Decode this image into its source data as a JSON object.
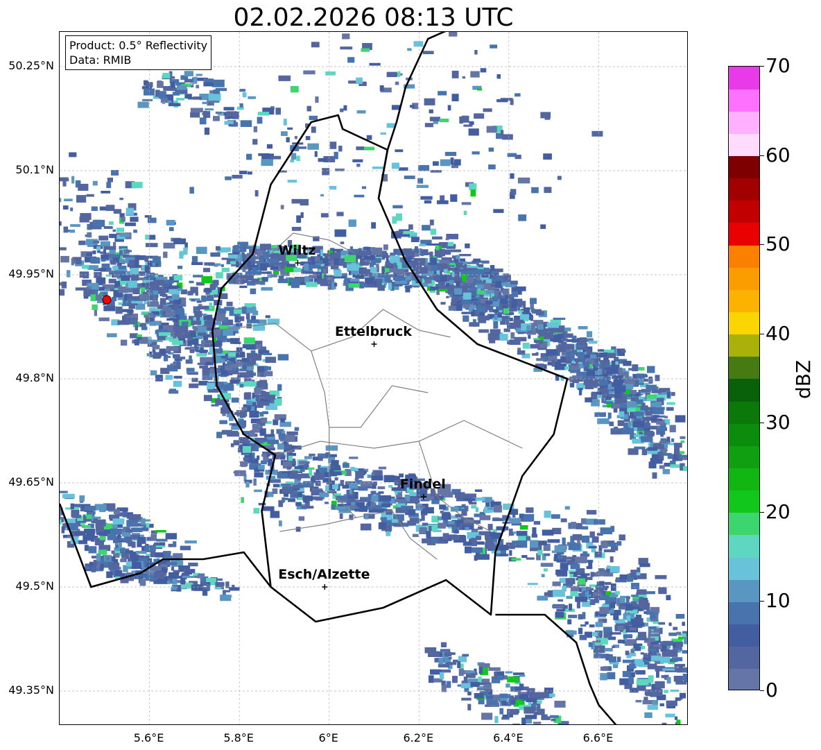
{
  "title": "02.02.2026 08:13 UTC",
  "product_box": {
    "line1": "Product: 0.5° Reflectivity",
    "line2": "Data: RMIB"
  },
  "map": {
    "lon_range": [
      5.4,
      6.8
    ],
    "lat_range": [
      49.3,
      50.3
    ],
    "lat_ticks": [
      {
        "value": 50.25,
        "label": "50.25°N"
      },
      {
        "value": 50.1,
        "label": "50.1°N"
      },
      {
        "value": 49.95,
        "label": "49.95°N"
      },
      {
        "value": 49.8,
        "label": "49.8°N"
      },
      {
        "value": 49.65,
        "label": "49.65°N"
      },
      {
        "value": 49.5,
        "label": "49.5°N"
      },
      {
        "value": 49.35,
        "label": "49.35°N"
      }
    ],
    "lon_ticks": [
      {
        "value": 5.6,
        "label": "5.6°E"
      },
      {
        "value": 5.8,
        "label": "5.8°E"
      },
      {
        "value": 6.0,
        "label": "6°E"
      },
      {
        "value": 6.2,
        "label": "6.2°E"
      },
      {
        "value": 6.4,
        "label": "6.4°E"
      },
      {
        "value": 6.6,
        "label": "6.6°E"
      }
    ],
    "grid": true,
    "cities": [
      {
        "name": "Wiltz",
        "lon": 5.93,
        "lat": 49.967
      },
      {
        "name": "Ettelbruck",
        "lon": 6.1,
        "lat": 49.85
      },
      {
        "name": "Findel",
        "lon": 6.21,
        "lat": 49.63
      },
      {
        "name": "Esch/Alzette",
        "lon": 5.99,
        "lat": 49.5
      }
    ],
    "radar_site": {
      "lon": 5.505,
      "lat": 49.914,
      "color": "#ff0000"
    },
    "lux_border": [
      [
        6.02,
        50.18
      ],
      [
        5.96,
        50.17
      ],
      [
        5.9,
        50.11
      ],
      [
        5.87,
        50.08
      ],
      [
        5.83,
        49.98
      ],
      [
        5.76,
        49.93
      ],
      [
        5.74,
        49.87
      ],
      [
        5.75,
        49.79
      ],
      [
        5.81,
        49.72
      ],
      [
        5.88,
        49.69
      ],
      [
        5.85,
        49.61
      ],
      [
        5.87,
        49.5
      ],
      [
        5.97,
        49.45
      ],
      [
        6.12,
        49.47
      ],
      [
        6.26,
        49.51
      ],
      [
        6.36,
        49.46
      ],
      [
        6.37,
        49.55
      ],
      [
        6.43,
        49.66
      ],
      [
        6.5,
        49.72
      ],
      [
        6.53,
        49.8
      ],
      [
        6.45,
        49.82
      ],
      [
        6.33,
        49.85
      ],
      [
        6.24,
        49.9
      ],
      [
        6.17,
        49.97
      ],
      [
        6.11,
        50.06
      ],
      [
        6.13,
        50.13
      ],
      [
        6.03,
        50.16
      ]
    ],
    "ger_bel_border": [
      [
        6.29,
        50.31
      ],
      [
        6.22,
        50.29
      ],
      [
        6.17,
        50.22
      ],
      [
        6.15,
        50.17
      ],
      [
        6.13,
        50.13
      ],
      [
        6.11,
        50.06
      ]
    ],
    "fra_bel_border": [
      [
        5.4,
        49.62
      ],
      [
        5.47,
        49.5
      ],
      [
        5.58,
        49.52
      ],
      [
        5.63,
        49.54
      ],
      [
        5.72,
        49.54
      ],
      [
        5.81,
        49.55
      ],
      [
        5.87,
        49.5
      ]
    ],
    "fra_ger_border": [
      [
        6.37,
        49.46
      ],
      [
        6.48,
        49.46
      ],
      [
        6.55,
        49.42
      ],
      [
        6.58,
        49.36
      ],
      [
        6.6,
        49.33
      ],
      [
        6.64,
        49.3
      ]
    ],
    "cantons": [
      [
        [
          5.87,
          49.98
        ],
        [
          5.92,
          50.01
        ],
        [
          6.0,
          50.0
        ],
        [
          6.06,
          49.98
        ]
      ],
      [
        [
          5.75,
          49.87
        ],
        [
          5.88,
          49.88
        ],
        [
          5.96,
          49.84
        ],
        [
          6.05,
          49.86
        ],
        [
          6.12,
          49.9
        ],
        [
          6.2,
          49.87
        ],
        [
          6.27,
          49.86
        ]
      ],
      [
        [
          5.96,
          49.84
        ],
        [
          5.99,
          49.78
        ],
        [
          6.0,
          49.73
        ],
        [
          6.07,
          49.73
        ],
        [
          6.14,
          49.79
        ],
        [
          6.22,
          49.78
        ]
      ],
      [
        [
          5.88,
          49.69
        ],
        [
          5.98,
          49.71
        ],
        [
          6.1,
          49.7
        ],
        [
          6.2,
          49.71
        ],
        [
          6.3,
          49.74
        ],
        [
          6.43,
          49.7
        ]
      ],
      [
        [
          6.0,
          49.73
        ],
        [
          6.0,
          49.64
        ],
        [
          6.06,
          49.6
        ],
        [
          6.14,
          49.61
        ],
        [
          6.18,
          49.57
        ],
        [
          6.24,
          49.54
        ]
      ],
      [
        [
          5.89,
          49.58
        ],
        [
          5.99,
          49.59
        ],
        [
          6.06,
          49.6
        ]
      ],
      [
        [
          6.2,
          49.71
        ],
        [
          6.24,
          49.63
        ],
        [
          6.3,
          49.6
        ],
        [
          6.36,
          49.58
        ]
      ]
    ]
  },
  "colorbar": {
    "label": "dBZ",
    "min": 0,
    "max": 70,
    "ticks": [
      {
        "value": 0,
        "label": "0"
      },
      {
        "value": 10,
        "label": "10"
      },
      {
        "value": 20,
        "label": "20"
      },
      {
        "value": 30,
        "label": "30"
      },
      {
        "value": 40,
        "label": "40"
      },
      {
        "value": 50,
        "label": "50"
      },
      {
        "value": 60,
        "label": "60"
      },
      {
        "value": 70,
        "label": "70"
      }
    ],
    "colors": [
      "#6575a6",
      "#5466a0",
      "#435da1",
      "#4873ad",
      "#5a96c2",
      "#68c2da",
      "#5dd7c0",
      "#3dd56e",
      "#12c71c",
      "#12b612",
      "#109f10",
      "#0c8c0c",
      "#0a790a",
      "#096109",
      "#467a12",
      "#aab10a",
      "#fbd500",
      "#fbb200",
      "#fb9c00",
      "#fb7f00",
      "#e90000",
      "#c30000",
      "#a20000",
      "#7f0000",
      "#ffdcff",
      "#ffb1ff",
      "#ff70ff",
      "#e93ae9"
    ]
  }
}
